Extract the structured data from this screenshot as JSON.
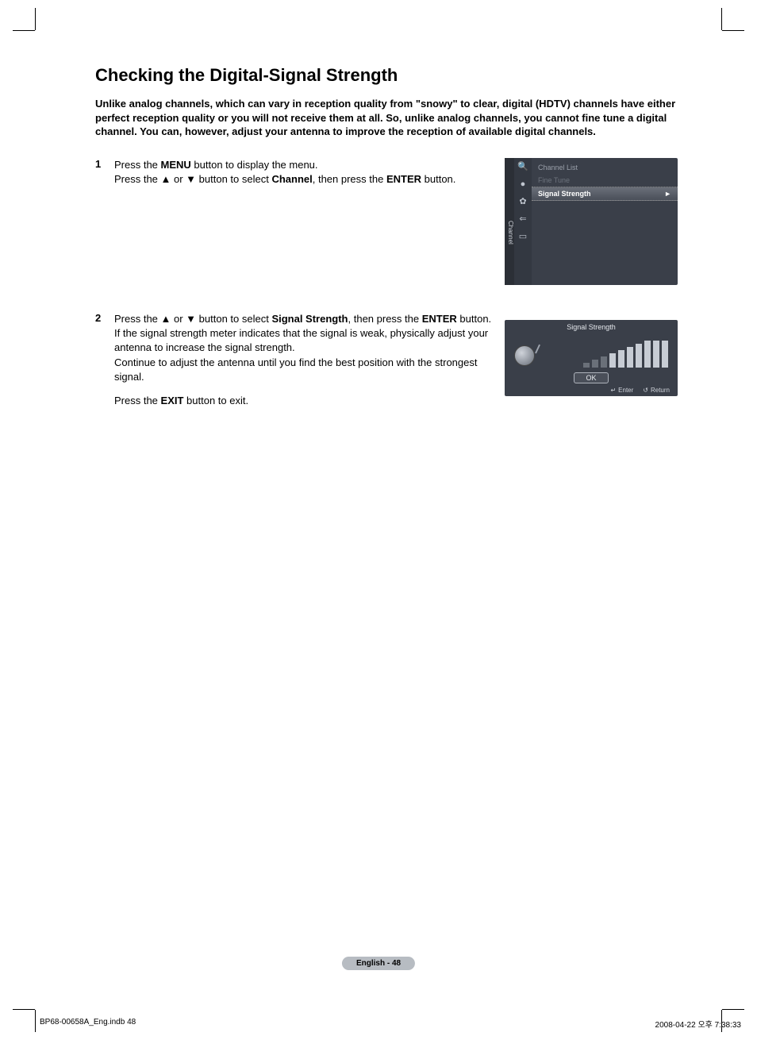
{
  "title": "Checking the Digital-Signal Strength",
  "intro": "Unlike analog channels, which can vary in reception quality from \"snowy\" to clear, digital (HDTV) channels have either perfect reception quality or you will not receive them at all. So, unlike analog channels, you cannot fine tune a digital channel. You can, however, adjust your antenna to improve the reception of available digital channels.",
  "steps": {
    "s1": {
      "num": "1",
      "l1a": "Press the ",
      "l1b": "MENU",
      "l1c": " button to display the menu.",
      "l2a": "Press the ▲ or ▼ button to select ",
      "l2b": "Channel",
      "l2c": ", then press the ",
      "l2d": "ENTER",
      "l2e": " button."
    },
    "s2": {
      "num": "2",
      "l1a": "Press the ▲ or ▼ button to select ",
      "l1b": "Signal Strength",
      "l1c": ", then press the ",
      "l1d": "ENTER",
      "l1e": " button. If the signal strength meter indicates that the signal is weak, physically adjust your antenna to increase the signal strength.",
      "l2": "Continue to adjust the antenna until you find the best position with the strongest signal.",
      "l3a": "Press the ",
      "l3b": "EXIT",
      "l3c": " button to exit."
    }
  },
  "osd1": {
    "tab": "Channel",
    "items": {
      "i0": "Channel List",
      "i1": "Fine Tune",
      "i2": "Signal Strength"
    },
    "arrow": "►"
  },
  "osd2": {
    "title": "Signal Strength",
    "ok": "OK",
    "enter_icon": "↵",
    "enter": "Enter",
    "return_icon": "↺",
    "return": "Return"
  },
  "pill": "English - 48",
  "footer": {
    "left": "BP68-00658A_Eng.indb   48",
    "right": "2008-04-22   오후 7:38:33"
  }
}
